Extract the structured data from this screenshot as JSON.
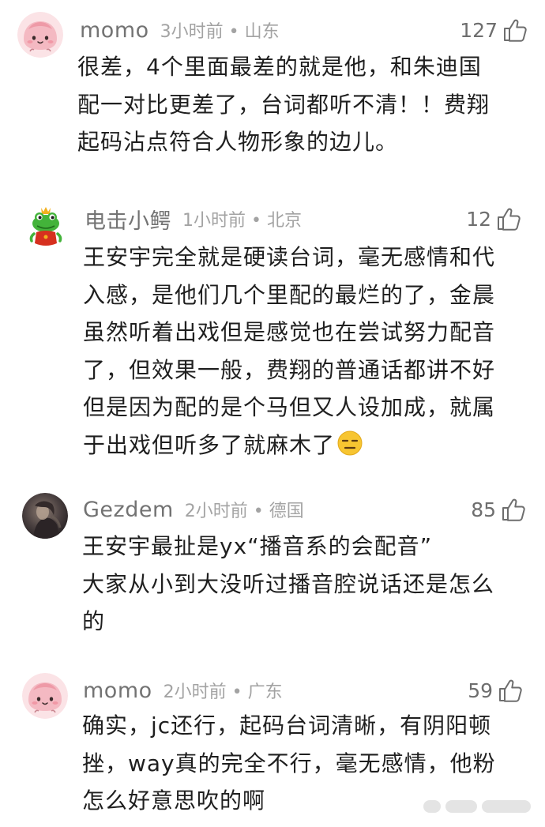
{
  "comments": [
    {
      "username": "momo",
      "time_location": "3小时前 • 山东",
      "likes": "127",
      "avatar_icon": "pink-blob-face-icon",
      "lines": [
        "很差，4个里面最差的就是他，和朱迪国",
        "配一对比更差了，台词都听不清！！费翔",
        "起码沾点符合人物形象的边儿。"
      ]
    },
    {
      "username": "电击小鳄",
      "time_location": "1小时前 • 北京",
      "likes": "12",
      "avatar_icon": "green-frog-crown-icon",
      "lines": [
        "王安宇完全就是硬读台词，毫无感情和代",
        "入感，是他们几个里配的最烂的了，金晨",
        "虽然听着出戏但是感觉也在尝试努力配音",
        "了，但效果一般，费翔的普通话都讲不好",
        "但是因为配的是个马但又人设加成，就属",
        "于出戏但听多了就麻木了"
      ],
      "emoji_icon": "expressionless-face-emoji-icon"
    },
    {
      "username": "Gezdem",
      "time_location": "2小时前 • 德国",
      "likes": "85",
      "avatar_icon": "dark-photo-avatar-icon",
      "lines": [
        "王安宇最扯是yx“播音系的会配音”",
        "大家从小到大没听过播音腔说话还是怎么",
        "的"
      ]
    },
    {
      "username": "momo",
      "time_location": "2小时前 • 广东",
      "likes": "59",
      "avatar_icon": "pink-blob-face-icon",
      "lines": [
        "确实，jc还行，起码台词清晰，有阴阳顿",
        "挫，way真的完全不行，毫无感情，他粉",
        "怎么好意思吹的啊"
      ]
    }
  ],
  "colors": {
    "username": "#737373",
    "meta": "#a3a3a3",
    "text": "#1f1f1f",
    "like_icon": "#6e6e6e"
  }
}
